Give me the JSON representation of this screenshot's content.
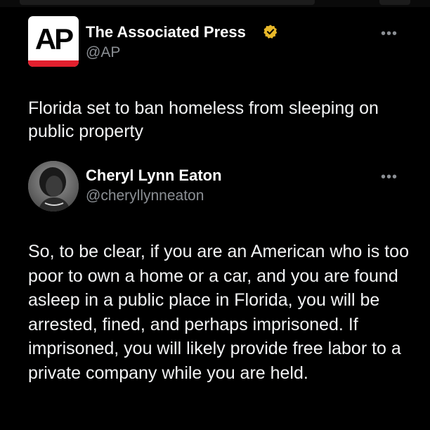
{
  "tweet": {
    "author_name": "The Associated Press",
    "handle": "@AP",
    "logo_text": "AP",
    "verified_icon": "verified-badge-icon",
    "more_icon": "more-options-icon",
    "more_label": "•••",
    "text": "Florida set to ban homeless from sleeping on public property"
  },
  "quote": {
    "author_name": "Cheryl Lynn Eaton",
    "handle": "@cheryllynneaton",
    "avatar_icon": "profile-avatar",
    "more_icon": "more-options-icon",
    "more_label": "•••",
    "text": "So, to be clear, if you are an American who is too poor to own a home or a car, and you are found asleep in a public place in Florida, you will be arrested, fined, and perhaps imprisoned. If imprisoned, you will likely provide free labor to a private company while you are held."
  },
  "colors": {
    "background": "#000000",
    "text": "#e7e9ea",
    "secondary_text": "#8b8f94",
    "verified_gold": "#e8b829",
    "ap_red": "#e2202e"
  }
}
